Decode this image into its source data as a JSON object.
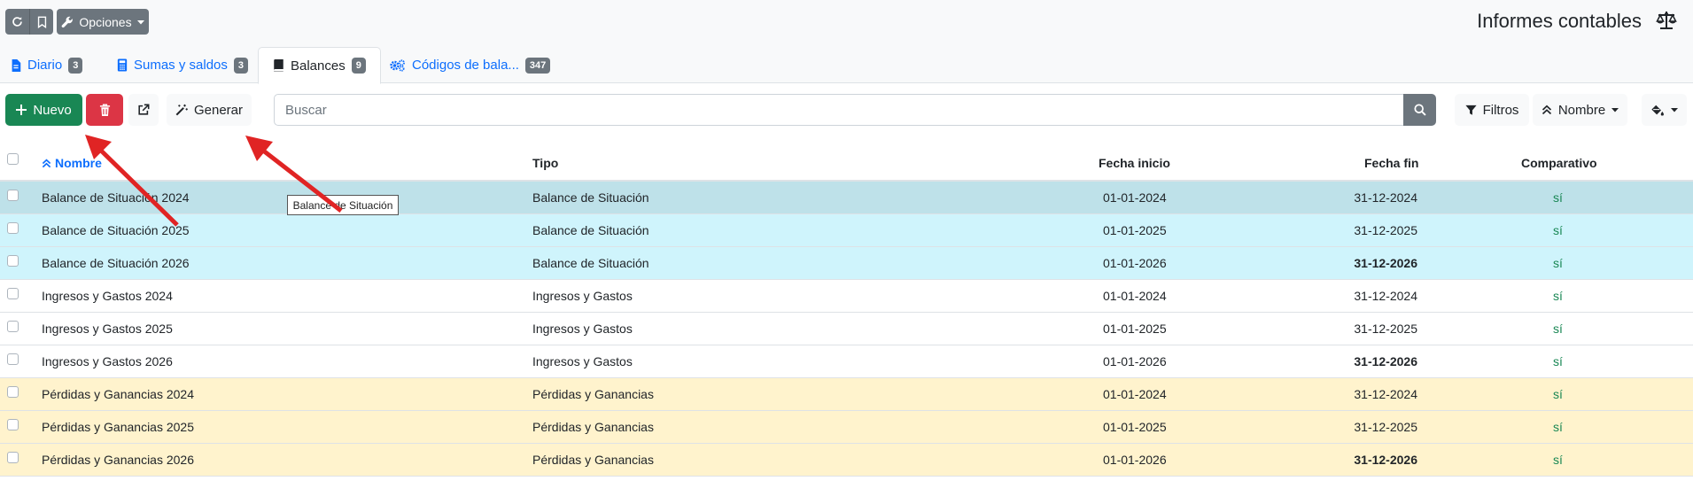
{
  "header": {
    "options_label": "Opciones",
    "title": "Informes contables"
  },
  "tabs": [
    {
      "label": "Diario",
      "count": "3"
    },
    {
      "label": "Sumas y saldos",
      "count": "3"
    },
    {
      "label": "Balances",
      "count": "9"
    },
    {
      "label": "Códigos de bala...",
      "count": "347"
    }
  ],
  "toolbar": {
    "new_label": "Nuevo",
    "generate_label": "Generar",
    "search_placeholder": "Buscar",
    "filters_label": "Filtros",
    "sort_label": "Nombre"
  },
  "table": {
    "columns": [
      "Nombre",
      "Tipo",
      "Fecha inicio",
      "Fecha fin",
      "Comparativo"
    ],
    "rows": [
      {
        "name": "Balance de Situación 2024",
        "tipo": "Balance de Situación",
        "inicio": "01-01-2024",
        "fin": "31-12-2024",
        "comparativo": "sí"
      },
      {
        "name": "Balance de Situación 2025",
        "tipo": "Balance de Situación",
        "inicio": "01-01-2025",
        "fin": "31-12-2025",
        "comparativo": "sí"
      },
      {
        "name": "Balance de Situación 2026",
        "tipo": "Balance de Situación",
        "inicio": "01-01-2026",
        "fin": "31-12-2026",
        "comparativo": "sí"
      },
      {
        "name": "Ingresos y Gastos 2024",
        "tipo": "Ingresos y Gastos",
        "inicio": "01-01-2024",
        "fin": "31-12-2024",
        "comparativo": "sí"
      },
      {
        "name": "Ingresos y Gastos 2025",
        "tipo": "Ingresos y Gastos",
        "inicio": "01-01-2025",
        "fin": "31-12-2025",
        "comparativo": "sí"
      },
      {
        "name": "Ingresos y Gastos 2026",
        "tipo": "Ingresos y Gastos",
        "inicio": "01-01-2026",
        "fin": "31-12-2026",
        "comparativo": "sí"
      },
      {
        "name": "Pérdidas y Ganancias 2024",
        "tipo": "Pérdidas y Ganancias",
        "inicio": "01-01-2024",
        "fin": "31-12-2024",
        "comparativo": "sí"
      },
      {
        "name": "Pérdidas y Ganancias 2025",
        "tipo": "Pérdidas y Ganancias",
        "inicio": "01-01-2025",
        "fin": "31-12-2025",
        "comparativo": "sí"
      },
      {
        "name": "Pérdidas y Ganancias 2026",
        "tipo": "Pérdidas y Ganancias",
        "inicio": "01-01-2026",
        "fin": "31-12-2026",
        "comparativo": "sí"
      }
    ]
  },
  "tooltip": "Balance de Situación",
  "colors": {
    "row_hover": "#bee1e9",
    "row_info": "#cff4fc",
    "row_warning": "#fff3cd",
    "annotation_arrow": "#e02424"
  }
}
